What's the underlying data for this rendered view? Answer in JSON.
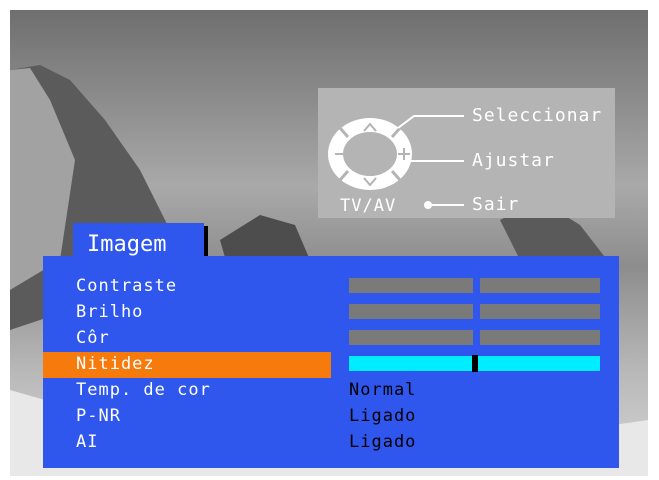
{
  "guide": {
    "select_label": "Seleccionar",
    "adjust_label": "Ajustar",
    "exit_label": "Sair",
    "tvav_label": "TV/AV"
  },
  "menu": {
    "title": "Imagem",
    "items": [
      {
        "label": "Contraste",
        "control": "slider",
        "level": 0.5
      },
      {
        "label": "Brilho",
        "control": "slider",
        "level": 0.5
      },
      {
        "label": "Côr",
        "control": "slider",
        "level": 0.5
      },
      {
        "label": "Nitidez",
        "control": "slider",
        "level": 0.5,
        "selected": true
      },
      {
        "label": "Temp. de cor",
        "value": "Normal"
      },
      {
        "label": "P-NR",
        "value": "Ligado"
      },
      {
        "label": "AI",
        "value": "Ligado"
      }
    ]
  },
  "colors": {
    "panel": "#2f57ee",
    "highlight": "#f67a0c",
    "active_bar": "#00ecff",
    "inactive_bar": "#7a7a7a"
  }
}
